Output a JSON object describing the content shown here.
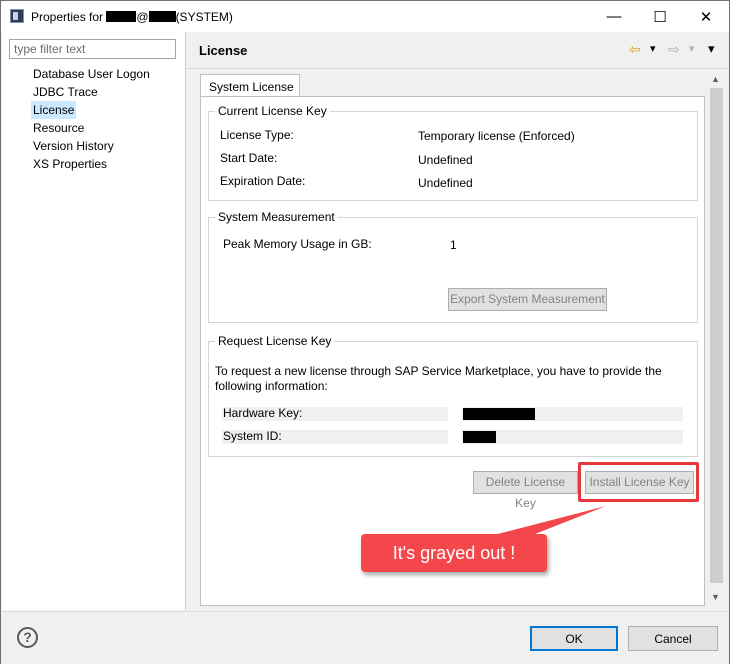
{
  "window": {
    "title_prefix": "Properties for",
    "title_at": "@",
    "title_suffix": "(SYSTEM)",
    "minimize_glyph": "—",
    "maximize_glyph": "☐",
    "close_glyph": "✕"
  },
  "sidebar": {
    "filter_placeholder": "type filter text",
    "items": [
      {
        "label": "Database User Logon"
      },
      {
        "label": "JDBC Trace"
      },
      {
        "label": "License",
        "selected": true
      },
      {
        "label": "Resource"
      },
      {
        "label": "Version History"
      },
      {
        "label": "XS Properties"
      }
    ]
  },
  "header": {
    "title": "License",
    "back_glyph": "⇦",
    "forward_glyph": "⇨",
    "menu_glyph": "▾"
  },
  "tabs": [
    {
      "label": "System License",
      "active": true
    }
  ],
  "current_license": {
    "title": "Current License Key",
    "rows": [
      {
        "label": "License Type:",
        "value": "Temporary license (Enforced)"
      },
      {
        "label": "Start Date:",
        "value": "Undefined"
      },
      {
        "label": "Expiration Date:",
        "value": "Undefined"
      }
    ]
  },
  "measurement": {
    "title": "System Measurement",
    "label": "Peak Memory Usage in GB:",
    "value": "1",
    "export_button": "Export System Measurement"
  },
  "request": {
    "title": "Request License Key",
    "description": "To request a new license through SAP Service Marketplace, you have to provide the following information:",
    "hardware_key_label": "Hardware Key:",
    "system_id_label": "System ID:"
  },
  "actions": {
    "delete_button": "Delete License Key",
    "install_button": "Install License Key"
  },
  "annotation": {
    "text": "It's grayed out !",
    "color": "#f4474c"
  },
  "footer": {
    "help_glyph": "?",
    "ok_button": "OK",
    "cancel_button": "Cancel"
  }
}
